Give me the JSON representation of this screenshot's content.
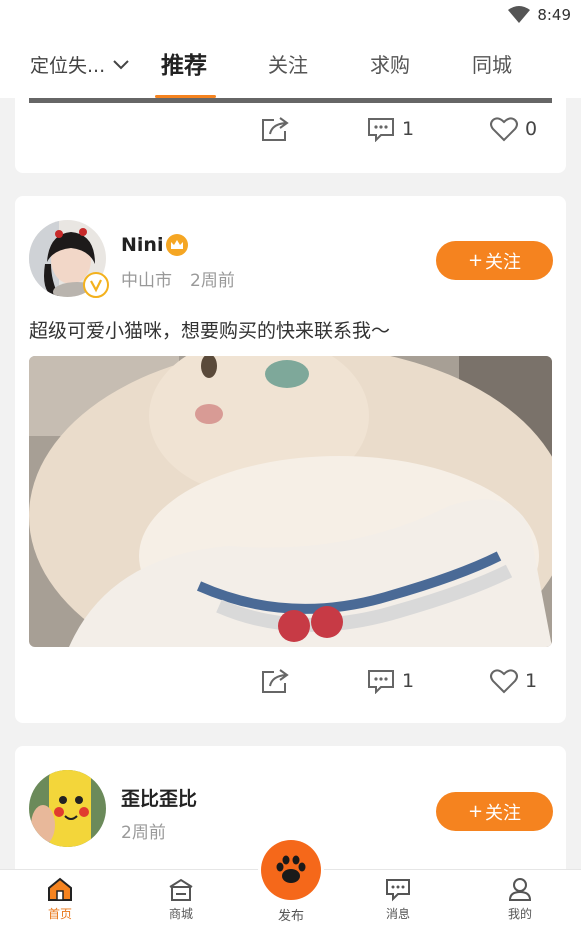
{
  "status": {
    "time": "8:49"
  },
  "top_nav": {
    "location": "定位失...",
    "tabs": [
      {
        "label": "推荐",
        "active": true
      },
      {
        "label": "关注",
        "active": false
      },
      {
        "label": "求购",
        "active": false
      },
      {
        "label": "同城",
        "active": false
      }
    ]
  },
  "posts": [
    {
      "share_count": "",
      "comment_count": "1",
      "like_count": "0"
    },
    {
      "username": "Nini",
      "city": "中山市",
      "time": "2周前",
      "follow_label": "关注",
      "text": "超级可爱小猫咪，想要购买的快来联系我～",
      "comment_count": "1",
      "like_count": "1"
    },
    {
      "username": "歪比歪比",
      "time": "2周前",
      "follow_label": "关注"
    }
  ],
  "bottom_nav": {
    "items": [
      {
        "label": "首页",
        "active": true
      },
      {
        "label": "商城",
        "active": false
      },
      {
        "label": "发布",
        "active": false
      },
      {
        "label": "消息",
        "active": false
      },
      {
        "label": "我的",
        "active": false
      }
    ]
  },
  "colors": {
    "accent": "#f5831f",
    "publish": "#f5681a",
    "background": "#f2f2f2"
  }
}
